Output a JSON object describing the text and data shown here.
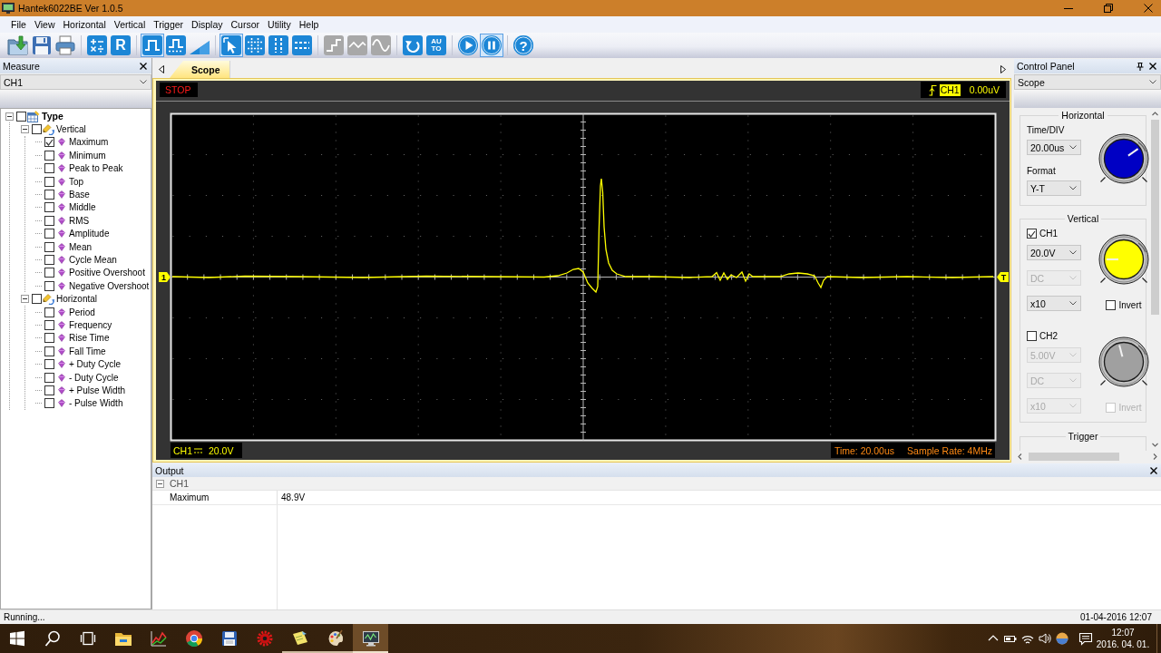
{
  "window": {
    "title": "Hantek6022BE Ver 1.0.5"
  },
  "menu": [
    "File",
    "View",
    "Horizontal",
    "Vertical",
    "Trigger",
    "Display",
    "Cursor",
    "Utility",
    "Help"
  ],
  "toolbar": [
    {
      "buttons": [
        {
          "kind": "open",
          "selected": false,
          "disabled": false
        },
        {
          "kind": "save",
          "selected": false,
          "disabled": false
        },
        {
          "kind": "print",
          "selected": false,
          "disabled": false
        }
      ]
    },
    {
      "buttons": [
        {
          "kind": "math",
          "selected": false,
          "disabled": false
        },
        {
          "kind": "reference",
          "label": "R",
          "selected": false,
          "disabled": false
        }
      ]
    },
    {
      "buttons": [
        {
          "kind": "pulse",
          "selected": true,
          "disabled": false
        },
        {
          "kind": "dotpulse",
          "selected": false,
          "disabled": false
        },
        {
          "kind": "ramp",
          "selected": false,
          "disabled": false
        }
      ]
    },
    {
      "buttons": [
        {
          "kind": "pointer",
          "selected": true,
          "disabled": false
        },
        {
          "kind": "grid",
          "selected": false,
          "disabled": false
        },
        {
          "kind": "vcursor",
          "selected": false,
          "disabled": false
        },
        {
          "kind": "hcursor",
          "selected": false,
          "disabled": false
        }
      ]
    },
    {
      "buttons": [
        {
          "kind": "step",
          "selected": false,
          "disabled": true
        },
        {
          "kind": "wave",
          "selected": false,
          "disabled": true
        },
        {
          "kind": "sine",
          "selected": false,
          "disabled": true
        }
      ]
    },
    {
      "buttons": [
        {
          "kind": "rotate",
          "selected": false,
          "disabled": false
        },
        {
          "kind": "auto",
          "label": "AU TO",
          "selected": false,
          "disabled": false
        }
      ]
    },
    {
      "buttons": [
        {
          "kind": "play",
          "selected": false,
          "disabled": false
        },
        {
          "kind": "pause",
          "selected": true,
          "disabled": false
        }
      ]
    },
    {
      "buttons": [
        {
          "kind": "help",
          "label": "?",
          "selected": false,
          "disabled": false
        }
      ]
    }
  ],
  "measure_panel": {
    "title": "Measure",
    "source": "CH1",
    "tree": [
      {
        "label": "Type",
        "checked": false,
        "expanded": true,
        "children": [
          {
            "label": "Vertical",
            "checked": false,
            "expanded": true,
            "children": [
              {
                "label": "Maximum",
                "checked": true
              },
              {
                "label": "Minimum",
                "checked": false
              },
              {
                "label": "Peak to Peak",
                "checked": false
              },
              {
                "label": "Top",
                "checked": false
              },
              {
                "label": "Base",
                "checked": false
              },
              {
                "label": "Middle",
                "checked": false
              },
              {
                "label": "RMS",
                "checked": false
              },
              {
                "label": "Amplitude",
                "checked": false
              },
              {
                "label": "Mean",
                "checked": false
              },
              {
                "label": "Cycle Mean",
                "checked": false
              },
              {
                "label": "Positive Overshoot",
                "checked": false
              },
              {
                "label": "Negative Overshoot",
                "checked": false
              }
            ]
          },
          {
            "label": "Horizontal",
            "checked": false,
            "expanded": true,
            "children": [
              {
                "label": "Period",
                "checked": false
              },
              {
                "label": "Frequency",
                "checked": false
              },
              {
                "label": "Rise Time",
                "checked": false
              },
              {
                "label": "Fall Time",
                "checked": false
              },
              {
                "label": "+ Duty Cycle",
                "checked": false
              },
              {
                "label": "- Duty Cycle",
                "checked": false
              },
              {
                "label": "+ Pulse Width",
                "checked": false
              },
              {
                "label": "- Pulse Width",
                "checked": false
              }
            ]
          }
        ]
      }
    ]
  },
  "tabs": [
    {
      "label": "Scope",
      "selected": true
    }
  ],
  "scope": {
    "run_state": "STOP",
    "trigger_source": "CH1",
    "trigger_value": "0.00uV",
    "channel_marker": "1",
    "trigger_marker": "T",
    "channel": "CH1",
    "volts_div": "20.0V",
    "time": "Time: 20.00us",
    "sample_rate": "Sample Rate: 4MHz"
  },
  "output": {
    "title": "Output",
    "groups": [
      {
        "label": "CH1",
        "expanded": true,
        "rows": [
          {
            "name": "Maximum",
            "value": "48.9V"
          }
        ]
      }
    ]
  },
  "control_panel": {
    "title": "Control Panel",
    "view": "Scope",
    "horizontal": {
      "title": "Horizontal",
      "time_div_label": "Time/DIV",
      "time_div": "20.00us",
      "format_label": "Format",
      "format": "Y-T"
    },
    "vertical": {
      "title": "Vertical",
      "channels": [
        {
          "label": "CH1",
          "checked": true,
          "color": "#ffff00",
          "volts": {
            "value": "20.0V",
            "disabled": false
          },
          "coupling": {
            "value": "DC",
            "disabled": true
          },
          "probe": {
            "value": "x10",
            "disabled": false
          },
          "invert": {
            "label": "Invert",
            "checked": false,
            "disabled": false
          }
        },
        {
          "label": "CH2",
          "checked": false,
          "color": "#a0a0a0",
          "volts": {
            "value": "5.00V",
            "disabled": true
          },
          "coupling": {
            "value": "DC",
            "disabled": true
          },
          "probe": {
            "value": "x10",
            "disabled": true
          },
          "invert": {
            "label": "Invert",
            "checked": false,
            "disabled": true
          }
        }
      ]
    },
    "trigger": {
      "title": "Trigger"
    }
  },
  "status_bar": {
    "message": "Running...",
    "datetime": "01-04-2016 12:07"
  },
  "taskbar": {
    "buttons": [
      {
        "kind": "start"
      },
      {
        "kind": "search"
      },
      {
        "kind": "taskview"
      }
    ],
    "apps": [
      {
        "kind": "folder",
        "running": false,
        "selected": false
      },
      {
        "kind": "chart",
        "running": false,
        "selected": false
      },
      {
        "kind": "browser",
        "running": false,
        "selected": false
      },
      {
        "kind": "floppy",
        "running": false,
        "selected": false
      },
      {
        "kind": "gear",
        "running": false,
        "selected": false
      },
      {
        "kind": "note",
        "running": true,
        "selected": false
      },
      {
        "kind": "palette",
        "running": true,
        "selected": false
      },
      {
        "kind": "monitor",
        "running": true,
        "selected": true
      }
    ],
    "tray": [
      {
        "kind": "chevron"
      },
      {
        "kind": "battery"
      },
      {
        "kind": "wifi"
      },
      {
        "kind": "volume"
      },
      {
        "kind": "ball"
      },
      {
        "kind": "message"
      }
    ],
    "clock": {
      "time": "12:07",
      "date": "2016. 04. 01."
    }
  }
}
